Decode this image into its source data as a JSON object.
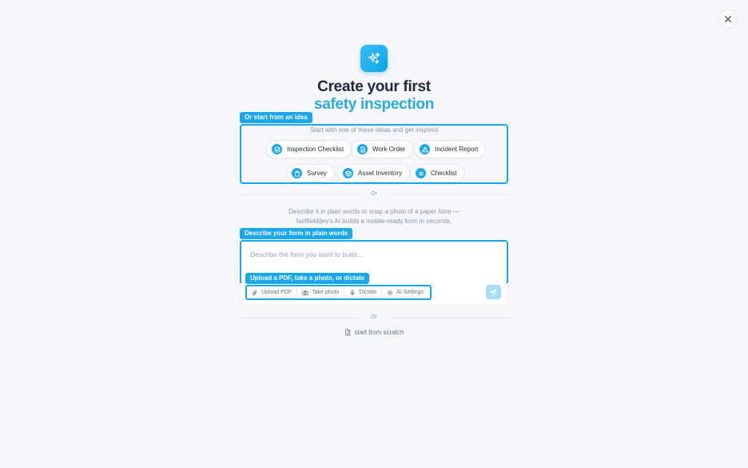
{
  "close": {
    "icon": "close-icon",
    "glyph": "✕"
  },
  "logo": {
    "icon": "sparkles-icon"
  },
  "heading": {
    "line1": "Create your first",
    "line2": "safety inspection"
  },
  "ideas": {
    "tag": "Or start from an idea",
    "hint": "Start with one of these ideas and get inspired",
    "chips": [
      {
        "label": "Inspection Checklist",
        "icon": "checklist-icon"
      },
      {
        "label": "Work Order",
        "icon": "document-icon"
      },
      {
        "label": "Incident Report",
        "icon": "warning-icon"
      },
      {
        "label": "Survey",
        "icon": "clipboard-icon"
      },
      {
        "label": "Asset Inventory",
        "icon": "box-icon"
      },
      {
        "label": "Checklist",
        "icon": "list-icon"
      }
    ]
  },
  "dividers": {
    "or1": "Or",
    "or2": "Or"
  },
  "description": {
    "line1": "Describe it in plain words or snap a photo of a paper form —",
    "line2": "fastfielddev's AI builds a mobile-ready form in seconds."
  },
  "describe": {
    "tag": "Describe your form in plain words",
    "placeholder": "Describe the form you want to build..."
  },
  "upload": {
    "tag": "Upload a PDF, take a photo, or dictate",
    "tools": [
      {
        "label": "Upload PDF",
        "icon": "paperclip-icon"
      },
      {
        "label": "Take photo",
        "icon": "camera-icon"
      },
      {
        "label": "Dictate",
        "icon": "microphone-icon"
      },
      {
        "label": "AI Settings",
        "icon": "gear-icon"
      }
    ],
    "send_icon": "send-icon"
  },
  "scratch": {
    "label": "start from scratch",
    "icon": "file-icon"
  },
  "colors": {
    "accent": "#1aa7ec",
    "heading_accent": "#29abe2",
    "background": "#f5f7fb"
  }
}
